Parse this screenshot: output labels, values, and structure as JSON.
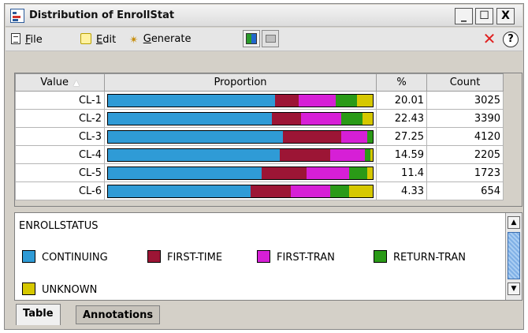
{
  "window": {
    "title": "Distribution of EnrollStat"
  },
  "title_buttons": {
    "minimize": "_",
    "maximize": "☐",
    "close": "X"
  },
  "menu": {
    "file": {
      "mnemonic": "F",
      "rest": "ile"
    },
    "edit": {
      "mnemonic": "E",
      "rest": "dit"
    },
    "generate": {
      "mnemonic": "G",
      "rest": "enerate"
    }
  },
  "toolbar": {
    "delete": "✕",
    "help": "?"
  },
  "table": {
    "columns": [
      "Value",
      "Proportion",
      "%",
      "Count"
    ],
    "sort_indicator": "▲",
    "rows": [
      {
        "value": "CL-1",
        "percent": "20.01",
        "count": "3025",
        "segments": [
          0.63,
          0.09,
          0.14,
          0.08,
          0.06
        ]
      },
      {
        "value": "CL-2",
        "percent": "22.43",
        "count": "3390",
        "segments": [
          0.62,
          0.11,
          0.15,
          0.08,
          0.04
        ]
      },
      {
        "value": "CL-3",
        "percent": "27.25",
        "count": "4120",
        "segments": [
          0.66,
          0.22,
          0.1,
          0.02,
          0.0
        ]
      },
      {
        "value": "CL-4",
        "percent": "14.59",
        "count": "2205",
        "segments": [
          0.65,
          0.19,
          0.13,
          0.02,
          0.01
        ]
      },
      {
        "value": "CL-5",
        "percent": "11.4",
        "count": "1723",
        "segments": [
          0.58,
          0.17,
          0.16,
          0.07,
          0.02
        ]
      },
      {
        "value": "CL-6",
        "percent": "4.33",
        "count": "654",
        "segments": [
          0.54,
          0.15,
          0.15,
          0.07,
          0.09
        ]
      }
    ]
  },
  "legend": {
    "title": "ENROLLSTATUS",
    "items": [
      {
        "label": "CONTINUING",
        "color": "#2f9bd6"
      },
      {
        "label": "FIRST-TIME",
        "color": "#9c1535"
      },
      {
        "label": "FIRST-TRAN",
        "color": "#d61fd6"
      },
      {
        "label": "RETURN-TRAN",
        "color": "#2a9a17"
      },
      {
        "label": "UNKNOWN",
        "color": "#d6c800"
      }
    ]
  },
  "tabs": [
    "Table",
    "Annotations"
  ]
}
